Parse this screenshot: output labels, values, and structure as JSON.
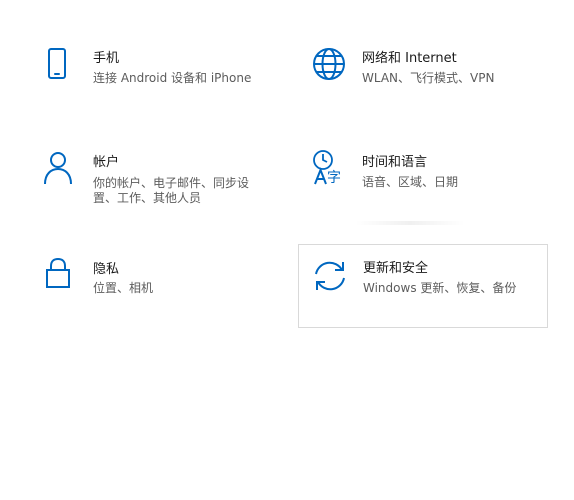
{
  "accent_color": "#0067c0",
  "tiles": [
    {
      "title": "手机",
      "description": "连接 Android 设备和 iPhone",
      "icon": "phone-icon"
    },
    {
      "title": "网络和 Internet",
      "description": "WLAN、飞行模式、VPN",
      "icon": "globe-icon"
    },
    {
      "title": "帐户",
      "description_line1": "你的帐户、电子邮件、同步设",
      "description_line2": "置、工作、其他人员",
      "icon": "person-icon"
    },
    {
      "title": "时间和语言",
      "description": "语音、区域、日期",
      "icon": "time-language-icon",
      "glyph": "字"
    },
    {
      "title": "隐私",
      "description": "位置、相机",
      "icon": "lock-icon"
    },
    {
      "title": "更新和安全",
      "description": "Windows 更新、恢复、备份",
      "icon": "sync-icon"
    }
  ]
}
